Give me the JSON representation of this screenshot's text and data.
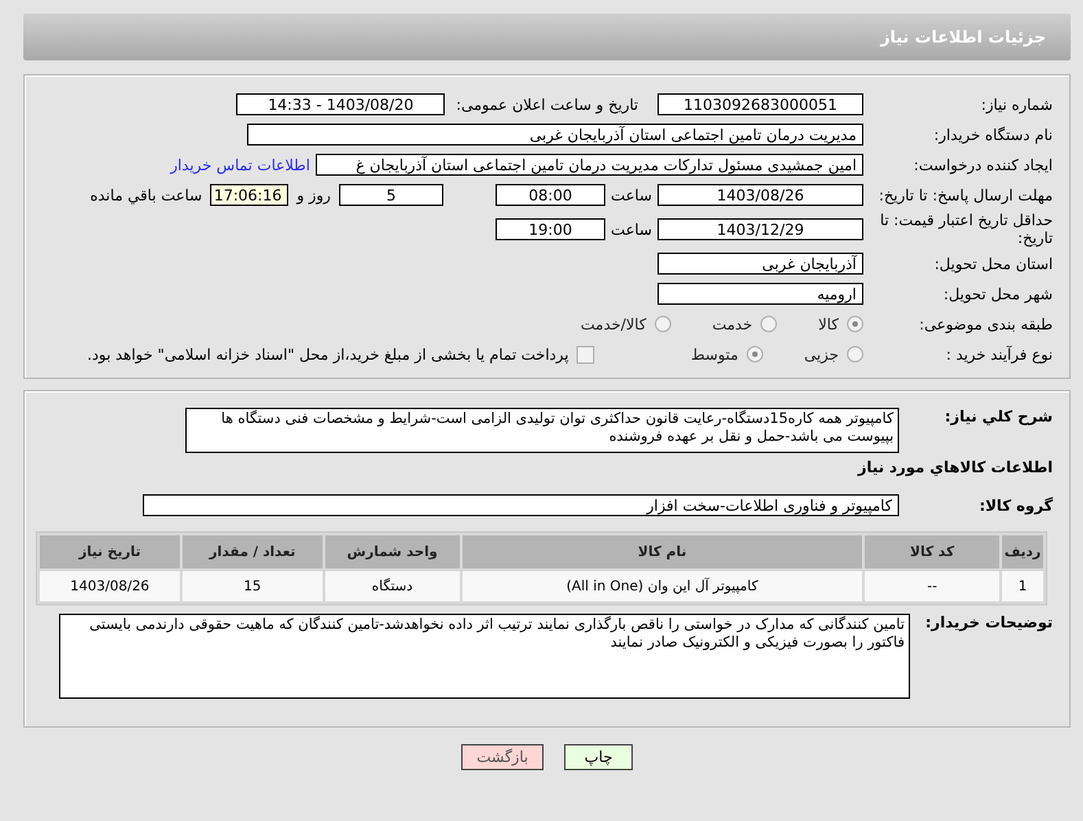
{
  "header": {
    "title": "جزئیات اطلاعات نیاز"
  },
  "need_number": {
    "label": "شماره نیاز:",
    "value": "1103092683000051"
  },
  "announce": {
    "label": "تاریخ و ساعت اعلان عمومی:",
    "value": "1403/08/20 - 14:33"
  },
  "buyer_org": {
    "label": "نام دستگاه خریدار:",
    "value": "مدیریت درمان تامین اجتماعی استان آذربایجان غربی"
  },
  "requester": {
    "label": "ایجاد کننده درخواست:",
    "value": "امین جمشیدی مسئول تدارکات مدیریت درمان تامین اجتماعی استان آذربایجان غ",
    "link": "اطلاعات تماس خریدار"
  },
  "reply_deadline": {
    "label": "مهلت ارسال پاسخ: تا تاریخ:",
    "date": "1403/08/26",
    "time_label": "ساعت",
    "time": "08:00",
    "days": "5",
    "days_label": "روز و",
    "remaining": "17:06:16",
    "remaining_label": "ساعت باقي مانده"
  },
  "price_validity": {
    "label": "حداقل تاریخ اعتبار قیمت: تا تاریخ:",
    "date": "1403/12/29",
    "time_label": "ساعت",
    "time": "19:00"
  },
  "province": {
    "label": "استان محل تحویل:",
    "value": "آذربایجان غربی"
  },
  "city": {
    "label": "شهر محل تحویل:",
    "value": "ارومیه"
  },
  "category": {
    "label": "طبقه بندی موضوعی:",
    "options": [
      {
        "label": "کالا",
        "selected": true
      },
      {
        "label": "خدمت",
        "selected": false
      },
      {
        "label": "کالا/خدمت",
        "selected": false
      }
    ]
  },
  "process": {
    "label": "نوع فرآیند خرید :",
    "options": [
      {
        "label": "جزیی",
        "selected": false
      },
      {
        "label": "متوسط",
        "selected": true
      }
    ],
    "payment": {
      "label": "پرداخت تمام یا بخشی از مبلغ خرید،از محل \"اسناد خزانه اسلامی\" خواهد بود.",
      "checked": false
    }
  },
  "description": {
    "label": "شرح کلي نیاز:",
    "value": "کامپیوتر همه کاره15دستگاه-رعایت قانون حداکثری توان تولیدی الزامی است-شرایط و مشخصات فنی دستگاه ها بپیوست می باشد-حمل و نقل بر عهده فروشنده"
  },
  "goods_title": "اطلاعات کالاهاي مورد نیاز",
  "goods_group": {
    "label": "گروه کالا:",
    "value": "کامپیوتر و فناوری اطلاعات-سخت افزار"
  },
  "table": {
    "columns": [
      "ردیف",
      "کد کالا",
      "نام کالا",
      "واحد شمارش",
      "تعداد / مقدار",
      "تاریخ نیاز"
    ],
    "rows": [
      [
        "1",
        "--",
        "کامپیوتر آل این وان (All in One)",
        "دستگاه",
        "15",
        "1403/08/26"
      ]
    ]
  },
  "buyer_notes": {
    "label": "توضیحات خریدار:",
    "value": "تامین کنندگانی که مدارک در خواستی را ناقص بارگذاری نمایند ترتیب اثر داده نخواهدشد-تامین کنندگان که ماهیت حقوقی دارندمی بایستی فاکتور را بصورت فیزیکی و الکترونیک صادر نمایند"
  },
  "buttons": [
    {
      "label": "چاپ",
      "kind": "print"
    },
    {
      "label": "بازگشت",
      "kind": "back"
    }
  ]
}
